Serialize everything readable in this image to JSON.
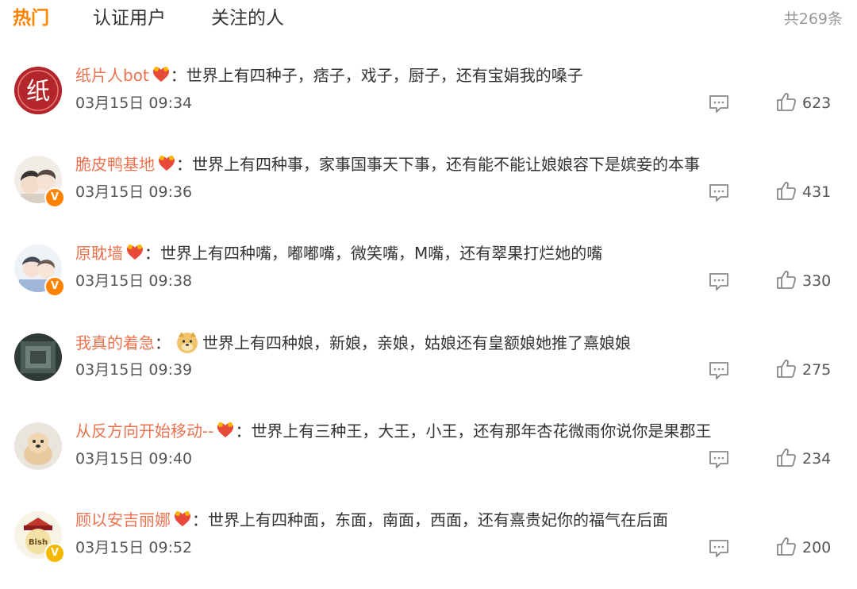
{
  "tabs": [
    {
      "label": "热门",
      "active": true
    },
    {
      "label": "认证用户",
      "active": false
    },
    {
      "label": "关注的人",
      "active": false
    }
  ],
  "total_count": "共269条",
  "comments": [
    {
      "user": "纸片人bot",
      "sep": "：",
      "text": "世界上有四种子，痞子，戏子，厨子，还有宝娟我的嗓子",
      "time": "03月15日 09:34",
      "likes": "623",
      "avatar_text": "纸"
    },
    {
      "user": "脆皮鸭基地",
      "sep": "：",
      "text": "世界上有四种事，家事国事天下事，还有能不能让娘娘容下是嫔妾的本事",
      "time": "03月15日 09:36",
      "likes": "431"
    },
    {
      "user": "原耽墙",
      "sep": "：",
      "text": "世界上有四种嘴，嘟嘟嘴，微笑嘴，M嘴，还有翠果打烂她的嘴",
      "time": "03月15日 09:38",
      "likes": "330"
    },
    {
      "user": "我真的着急",
      "sep": "：",
      "text": "世界上有四种娘，新娘，亲娘，姑娘还有皇额娘她推了熹娘娘",
      "time": "03月15日 09:39",
      "likes": "275"
    },
    {
      "user": "从反方向开始移动--",
      "sep": "：",
      "text": "世界上有三种王，大王，小王，还有那年杏花微雨你说你是果郡王",
      "time": "03月15日 09:40",
      "likes": "234"
    },
    {
      "user": "顾以安吉丽娜",
      "sep": "：",
      "text": "世界上有四种面，东面，南面，西面，还有熹贵妃你的福气在后面",
      "time": "03月15日 09:52",
      "likes": "200",
      "avatar_text": "Bish"
    }
  ],
  "colors": {
    "accent": "#ff8200",
    "username": "#eb7350",
    "text": "#333333",
    "muted": "#999999"
  }
}
